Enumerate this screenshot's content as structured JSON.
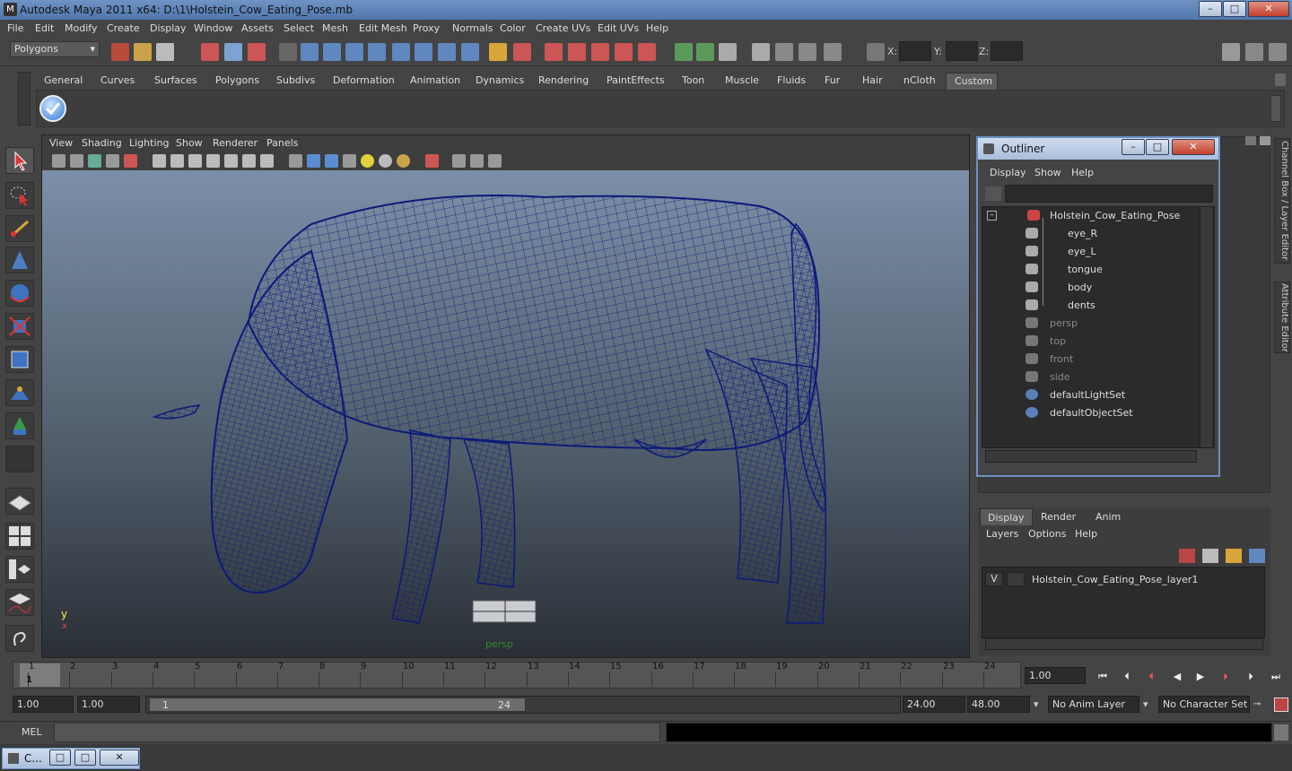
{
  "title": {
    "text": "Autodesk Maya 2011 x64: D:\\1\\Holstein_Cow_Eating_Pose.mb",
    "minimize": "–",
    "maximize": "□",
    "close": "✕"
  },
  "menubar": [
    "File",
    "Edit",
    "Modify",
    "Create",
    "Display",
    "Window",
    "Assets",
    "Select",
    "Mesh",
    "Edit Mesh",
    "Proxy",
    "Normals",
    "Color",
    "Create UVs",
    "Edit UVs",
    "Help"
  ],
  "status": {
    "mode_menu": "Polygons",
    "x_label": "X:",
    "y_label": "Y:",
    "z_label": "Z:"
  },
  "shelf_tabs": [
    "General",
    "Curves",
    "Surfaces",
    "Polygons",
    "Subdivs",
    "Deformation",
    "Animation",
    "Dynamics",
    "Rendering",
    "PaintEffects",
    "Toon",
    "Muscle",
    "Fluids",
    "Fur",
    "Hair",
    "nCloth",
    "Custom"
  ],
  "shelf_active": "Custom",
  "viewport": {
    "menu": [
      "View",
      "Shading",
      "Lighting",
      "Show",
      "Renderer",
      "Panels"
    ],
    "camera_label": "persp",
    "axis_y": "y",
    "axis_x": "x"
  },
  "outliner": {
    "title": "Outliner",
    "menu": [
      "Display",
      "Show",
      "Help"
    ],
    "items": [
      {
        "label": "Holstein_Cow_Eating_Pose",
        "icon": "group-icon"
      },
      {
        "label": "eye_R",
        "icon": "mesh-icon"
      },
      {
        "label": "eye_L",
        "icon": "mesh-icon"
      },
      {
        "label": "tongue",
        "icon": "mesh-icon"
      },
      {
        "label": "body",
        "icon": "mesh-icon"
      },
      {
        "label": "dents",
        "icon": "mesh-icon"
      },
      {
        "label": "persp",
        "icon": "camera-icon"
      },
      {
        "label": "top",
        "icon": "camera-icon"
      },
      {
        "label": "front",
        "icon": "camera-icon"
      },
      {
        "label": "side",
        "icon": "camera-icon"
      },
      {
        "label": "defaultLightSet",
        "icon": "set-icon"
      },
      {
        "label": "defaultObjectSet",
        "icon": "set-icon"
      }
    ],
    "collapse": "–"
  },
  "sidetabs": {
    "channel_box": "Channel Box / Layer Editor",
    "attribute_editor": "Attribute Editor"
  },
  "layers": {
    "tabs": [
      "Display",
      "Render",
      "Anim"
    ],
    "menu": [
      "Layers",
      "Options",
      "Help"
    ],
    "layer_visible": "V",
    "layer_name": "Holstein_Cow_Eating_Pose_layer1"
  },
  "timeline": {
    "ticks": [
      "1",
      "2",
      "3",
      "4",
      "5",
      "6",
      "7",
      "8",
      "9",
      "10",
      "11",
      "12",
      "13",
      "14",
      "15",
      "16",
      "17",
      "18",
      "19",
      "20",
      "21",
      "22",
      "23",
      "24"
    ],
    "current": "1",
    "current_time": "1.00"
  },
  "range": {
    "start": "1.00",
    "playback_start": "1.00",
    "slider_start": "1",
    "slider_end": "24",
    "playback_end": "24.00",
    "end": "48.00",
    "anim_layer": "No Anim Layer",
    "character_set": "No Character Set"
  },
  "cmd": {
    "label": "MEL"
  },
  "taskbar": {
    "label": "C..."
  },
  "colors": {
    "wireframe": "#0b1a7a",
    "accent": "#6d90c0",
    "bg": "#444444"
  }
}
